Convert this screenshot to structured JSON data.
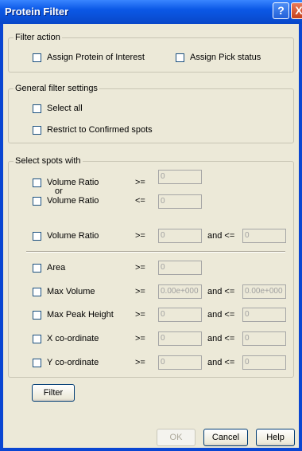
{
  "window": {
    "title": "Protein Filter",
    "help_glyph": "?",
    "close_glyph": "X"
  },
  "filter_action": {
    "legend": "Filter action",
    "assign_poi": "Assign Protein of Interest",
    "assign_pick": "Assign Pick status"
  },
  "general": {
    "legend": "General filter settings",
    "select_all": "Select all",
    "restrict": "Restrict to Confirmed spots"
  },
  "select_spots": {
    "legend": "Select spots with",
    "or_text": "or",
    "and_le": "and <=",
    "rows": [
      {
        "label": "Volume Ratio",
        "op": ">=",
        "v1": "0"
      },
      {
        "label": "Volume Ratio",
        "op": "<=",
        "v1": "0"
      },
      {
        "label": "Volume Ratio",
        "op": ">=",
        "v1": "0",
        "v2": "0"
      },
      {
        "label": "Area",
        "op": ">=",
        "v1": "0"
      },
      {
        "label": "Max Volume",
        "op": ">=",
        "v1": "0.00e+000",
        "v2": "0.00e+000"
      },
      {
        "label": "Max Peak Height",
        "op": ">=",
        "v1": "0",
        "v2": "0"
      },
      {
        "label": "X co-ordinate",
        "op": ">=",
        "v1": "0",
        "v2": "0"
      },
      {
        "label": "Y co-ordinate",
        "op": ">=",
        "v1": "0",
        "v2": "0"
      }
    ]
  },
  "buttons": {
    "filter": "Filter",
    "ok": "OK",
    "cancel": "Cancel",
    "help": "Help"
  }
}
